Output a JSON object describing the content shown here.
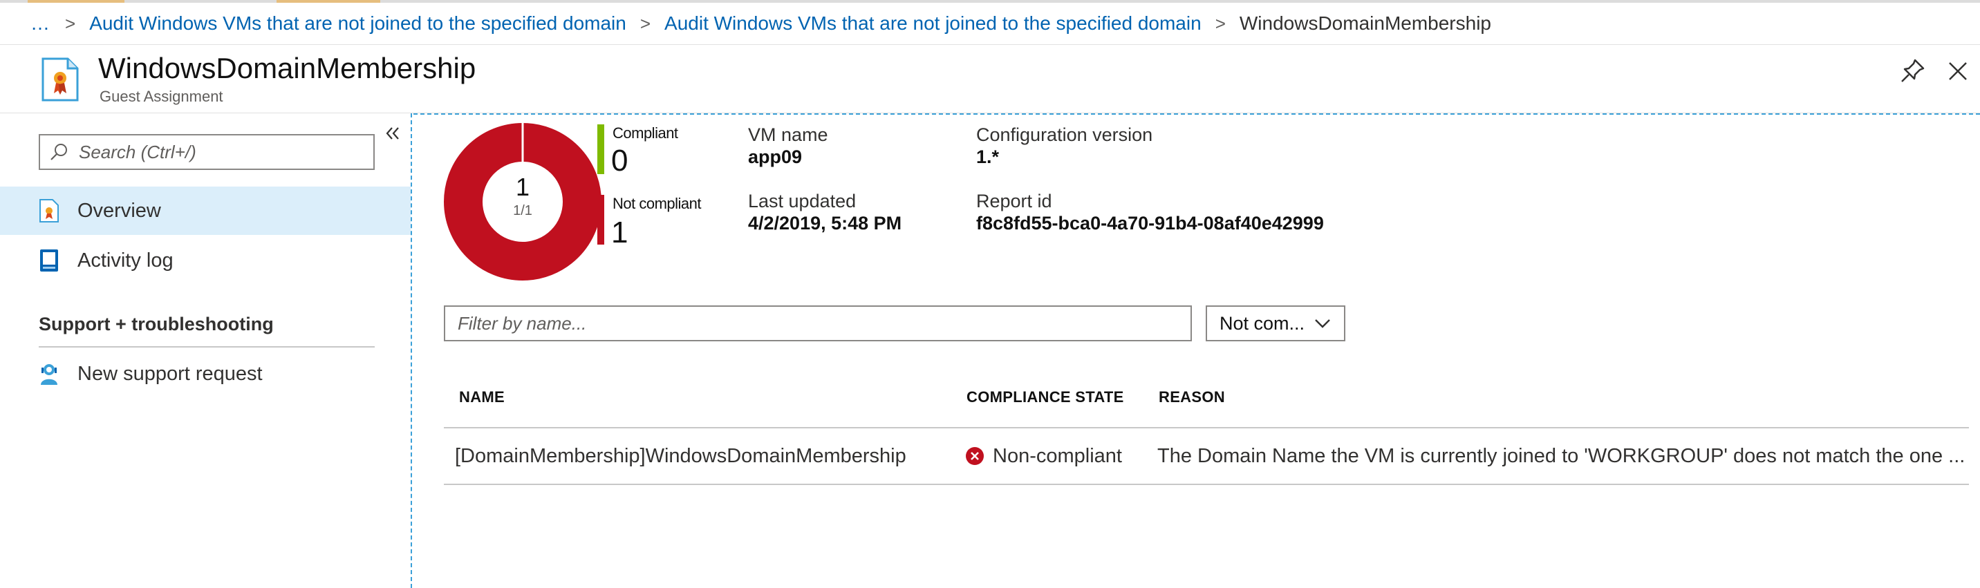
{
  "breadcrumb": {
    "ellipsis": "…",
    "items": [
      "Audit Windows VMs that are not joined to the specified domain",
      "Audit Windows VMs that are not joined to the specified domain"
    ],
    "current": "WindowsDomainMembership"
  },
  "header": {
    "title": "WindowsDomainMembership",
    "subtitle": "Guest Assignment"
  },
  "sidebar": {
    "search_placeholder": "Search (Ctrl+/)",
    "items": [
      {
        "label": "Overview",
        "icon": "overview-icon",
        "active": true
      },
      {
        "label": "Activity log",
        "icon": "activity-log-icon",
        "active": false
      }
    ],
    "section_title": "Support + troubleshooting",
    "section_items": [
      {
        "label": "New support request",
        "icon": "support-request-icon"
      }
    ]
  },
  "summary": {
    "donut_total": "1",
    "donut_ratio": "1/1",
    "compliant_label": "Compliant",
    "compliant_count": "0",
    "noncompliant_label": "Not compliant",
    "noncompliant_count": "1",
    "vm_name_label": "VM name",
    "vm_name": "app09",
    "last_updated_label": "Last updated",
    "last_updated": "4/2/2019, 5:48 PM",
    "config_version_label": "Configuration version",
    "config_version": "1.*",
    "report_id_label": "Report id",
    "report_id": "f8c8fd55-bca0-4a70-91b4-08af40e42999"
  },
  "filter": {
    "placeholder": "Filter by name...",
    "state_selected": "Not com..."
  },
  "table": {
    "columns": [
      "NAME",
      "COMPLIANCE STATE",
      "REASON"
    ],
    "rows": [
      {
        "name": "[DomainMembership]WindowsDomainMembership",
        "state": "Non-compliant",
        "reason": "The Domain Name the VM is currently joined to 'WORKGROUP' does not match the one ..."
      }
    ]
  },
  "colors": {
    "accent": "#0063b1",
    "noncompliant": "#c0101f",
    "compliant": "#7fba00",
    "active_menu": "#dbeefa"
  }
}
